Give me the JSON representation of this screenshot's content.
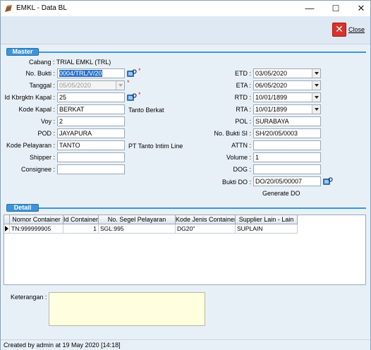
{
  "window": {
    "title": "EMKL - Data BL",
    "minimize": "—",
    "maximize": "☐",
    "close": "✕"
  },
  "toolbar": {
    "close_label": "Close"
  },
  "master": {
    "header": "Master",
    "cabang": "Cabang : TRIAL EMKL (TRL)",
    "left": [
      {
        "label": "No. Bukti :",
        "value": "0004/TRL/V/20"
      },
      {
        "label": "Tanggal :",
        "value": "05/05/2020"
      },
      {
        "label": "Id Kbrgktn Kapal :",
        "value": "25"
      },
      {
        "label": "Kode Kapal :",
        "value": "BERKAT",
        "extra": "Tanto Berkat"
      },
      {
        "label": "Voy :",
        "value": "2"
      },
      {
        "label": "POD :",
        "value": "JAYAPURA"
      },
      {
        "label": "Kode Pelayaran :",
        "value": "TANTO",
        "extra": "PT Tanto Intim Line"
      },
      {
        "label": "Shipper :",
        "value": ""
      },
      {
        "label": "Consignee :",
        "value": ""
      }
    ],
    "right": [
      {
        "label": "ETD :",
        "value": "03/05/2020"
      },
      {
        "label": "ETA :",
        "value": "06/05/2020"
      },
      {
        "label": "RTD :",
        "value": "10/01/1899"
      },
      {
        "label": "RTA :",
        "value": "10/01/1899"
      },
      {
        "label": "POL :",
        "value": "SURABAYA"
      },
      {
        "label": "No. Bukti SI :",
        "value": "SH/20/05/0003"
      },
      {
        "label": "ATTN :",
        "value": ""
      },
      {
        "label": "Volume :",
        "value": "1"
      },
      {
        "label": "DOG :",
        "value": ""
      },
      {
        "label": "Bukti DO :",
        "value": "DO/20/05/00007"
      }
    ],
    "required_mark": "*",
    "generate_do": "Generate DO"
  },
  "detail": {
    "header": "Detail",
    "columns": [
      "Nomor Container",
      "Id Container",
      "No. Segel Pelayaran",
      "Kode Jenis Container",
      "Supplier Lain  - Lain"
    ],
    "rows": [
      [
        "TN:999999905",
        "1",
        "SGL:995",
        "DG20''",
        "SUPLAIN"
      ]
    ]
  },
  "keterangan": {
    "label": "Keterangan :",
    "value": ""
  },
  "status": {
    "text": "Created by admin at 19 May 2020 [14:18]"
  },
  "colors": {
    "accent": "#3d95d9",
    "background": "#e8f0f7",
    "note_bg": "#ffffe0",
    "required": "#e02020"
  }
}
